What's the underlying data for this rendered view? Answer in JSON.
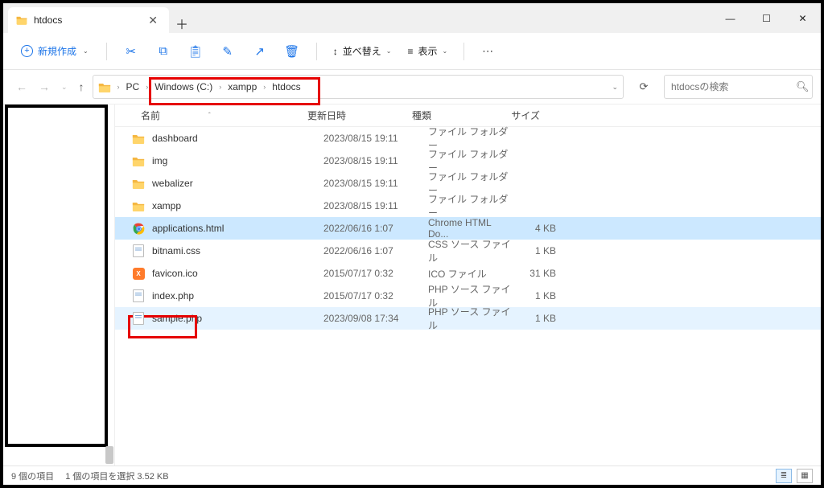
{
  "window": {
    "title": "htdocs"
  },
  "toolbar": {
    "new_label": "新規作成",
    "sort_label": "並べ替え",
    "view_label": "表示"
  },
  "breadcrumb": {
    "root": "PC",
    "parts": [
      "Windows (C:)",
      "xampp",
      "htdocs"
    ]
  },
  "search": {
    "placeholder": "htdocsの検索"
  },
  "columns": {
    "name": "名前",
    "date": "更新日時",
    "type": "種類",
    "size": "サイズ"
  },
  "files": [
    {
      "name": "dashboard",
      "date": "2023/08/15 19:11",
      "type": "ファイル フォルダー",
      "size": "",
      "kind": "folder",
      "state": ""
    },
    {
      "name": "img",
      "date": "2023/08/15 19:11",
      "type": "ファイル フォルダー",
      "size": "",
      "kind": "folder",
      "state": ""
    },
    {
      "name": "webalizer",
      "date": "2023/08/15 19:11",
      "type": "ファイル フォルダー",
      "size": "",
      "kind": "folder",
      "state": ""
    },
    {
      "name": "xampp",
      "date": "2023/08/15 19:11",
      "type": "ファイル フォルダー",
      "size": "",
      "kind": "folder",
      "state": ""
    },
    {
      "name": "applications.html",
      "date": "2022/06/16 1:07",
      "type": "Chrome HTML Do...",
      "size": "4 KB",
      "kind": "chrome",
      "state": "selected"
    },
    {
      "name": "bitnami.css",
      "date": "2022/06/16 1:07",
      "type": "CSS ソース ファイル",
      "size": "1 KB",
      "kind": "generic",
      "state": ""
    },
    {
      "name": "favicon.ico",
      "date": "2015/07/17 0:32",
      "type": "ICO ファイル",
      "size": "31 KB",
      "kind": "ico",
      "state": ""
    },
    {
      "name": "index.php",
      "date": "2015/07/17 0:32",
      "type": "PHP ソース ファイル",
      "size": "1 KB",
      "kind": "generic",
      "state": ""
    },
    {
      "name": "sample.php",
      "date": "2023/09/08 17:34",
      "type": "PHP ソース ファイル",
      "size": "1 KB",
      "kind": "generic",
      "state": "hover"
    }
  ],
  "status": {
    "count": "9 個の項目",
    "selected": "1 個の項目を選択 3.52 KB"
  }
}
